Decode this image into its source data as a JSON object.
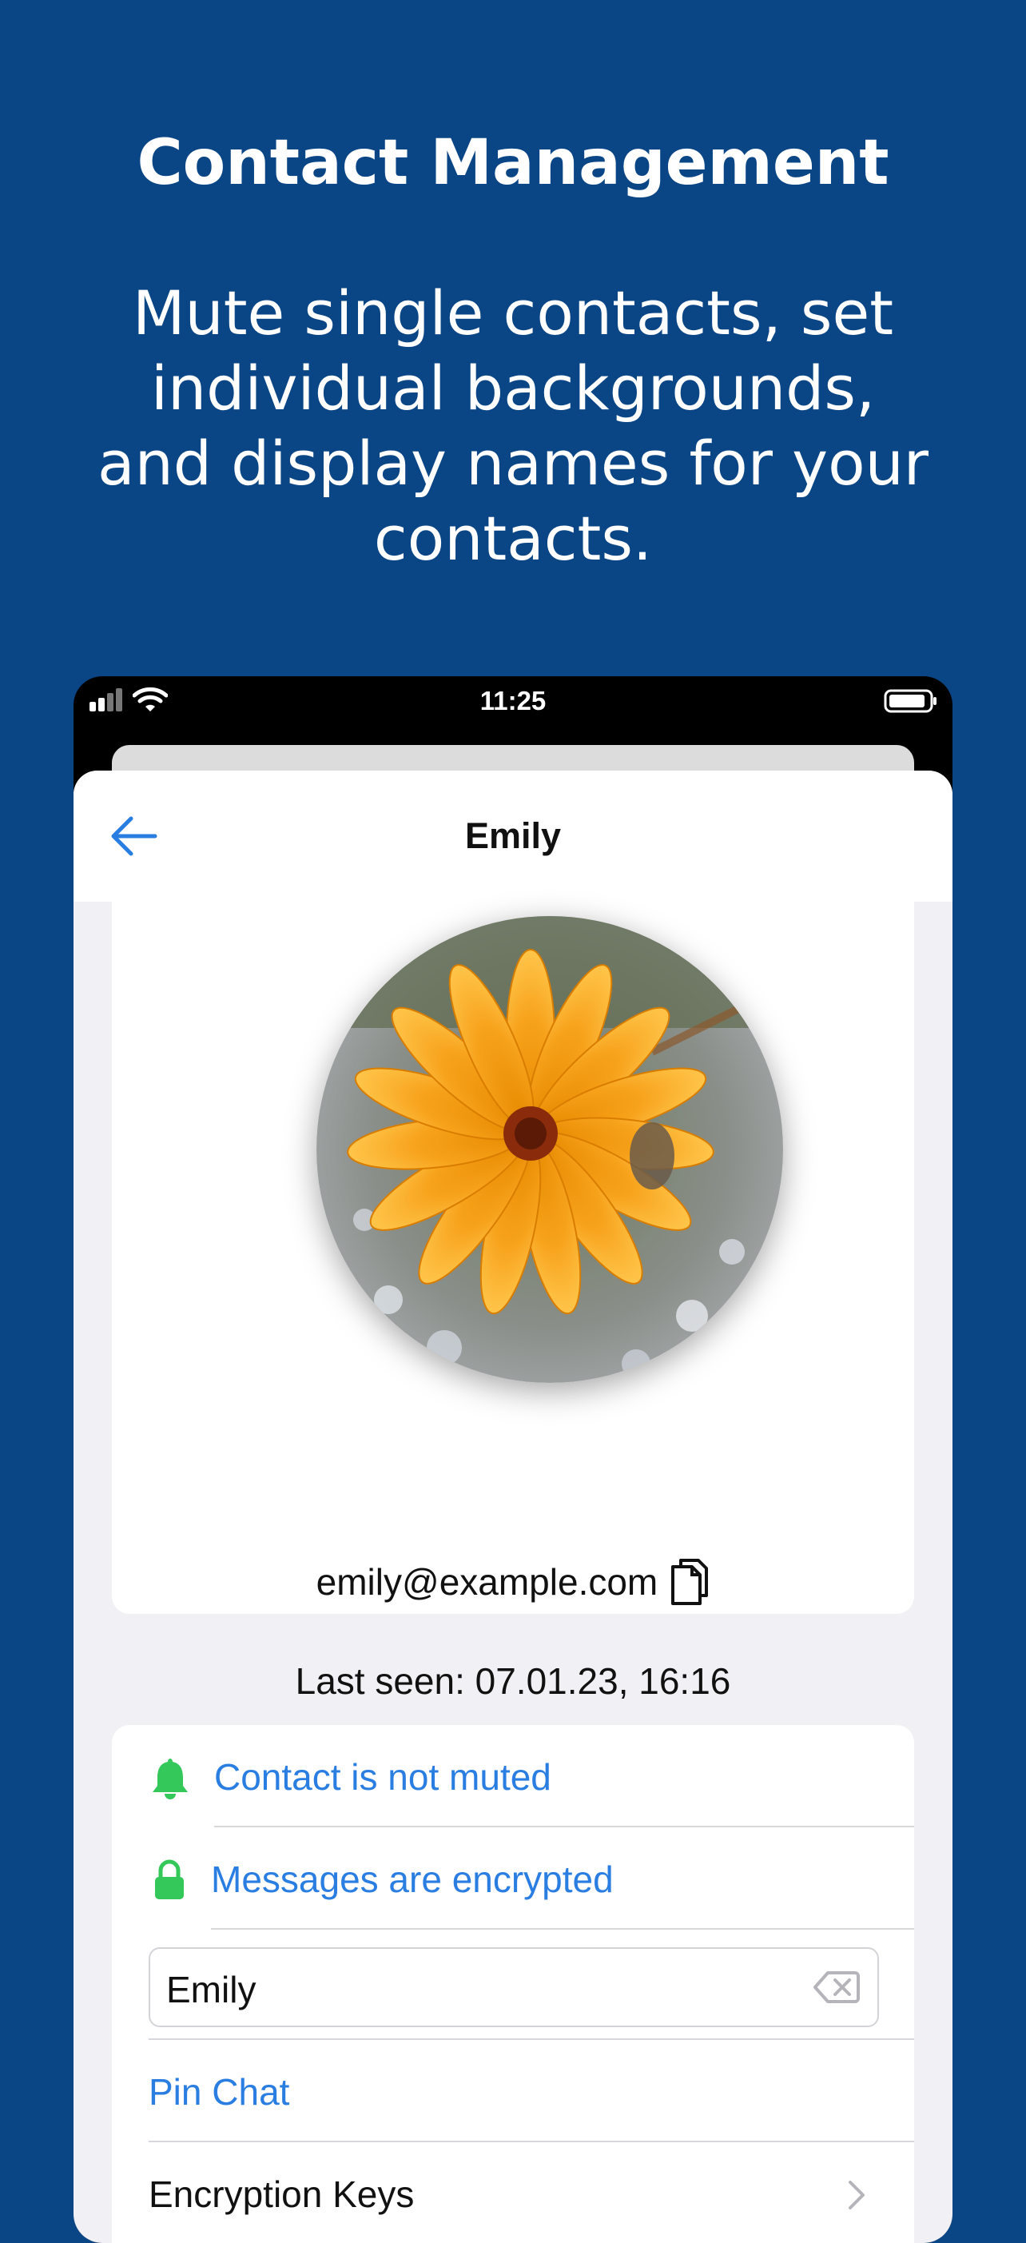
{
  "promo": {
    "title": "Contact Management",
    "subtitle": "Mute single contacts, set individual backgrounds, and display names for your contacts."
  },
  "status_bar": {
    "time": "11:25"
  },
  "nav": {
    "title": "Emily",
    "back_icon": "arrow-left-icon"
  },
  "profile": {
    "avatar_description_icon": "avatar-photo",
    "email": "emily@example.com",
    "copy_icon": "copy-icon",
    "last_seen": "Last seen: 07.01.23, 16:16"
  },
  "settings": {
    "mute_label": "Contact is not muted",
    "encrypted_label": "Messages are encrypted",
    "display_name_value": "Emily",
    "pin_label": "Pin Chat",
    "keys_label": "Encryption Keys"
  },
  "colors": {
    "background": "#0a4585",
    "accent_blue": "#2a7de1",
    "icon_green": "#34c759"
  }
}
